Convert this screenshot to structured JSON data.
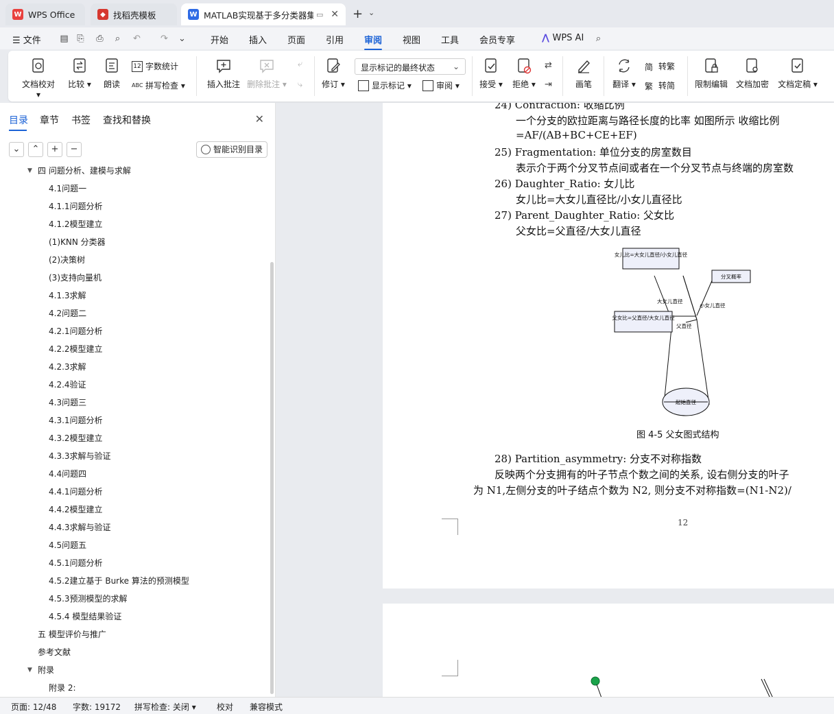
{
  "tabs": [
    {
      "label": "WPS Office",
      "icon": "wps-logo-icon"
    },
    {
      "label": "找稻壳模板",
      "icon": "docer-icon"
    },
    {
      "label": "MATLAB实现基于多分类器集",
      "icon": "word-doc-icon"
    }
  ],
  "menu": {
    "file": "文件",
    "items": [
      "开始",
      "插入",
      "页面",
      "引用",
      "审阅",
      "视图",
      "工具",
      "会员专享"
    ],
    "active": "审阅",
    "ai": "WPS AI"
  },
  "ribbon": {
    "doc_check": "文档校对",
    "compare": "比较",
    "read_aloud": "朗读",
    "word_count": "字数统计",
    "spell_check": "拼写检查",
    "insert_comment": "插入批注",
    "delete_comment": "删除批注",
    "revise": "修订",
    "markup_state": "显示标记的最终状态",
    "show_markup": "显示标记",
    "review": "审阅",
    "accept": "接受",
    "reject": "拒绝",
    "pen": "画笔",
    "translate": "翻译",
    "trad_simp": "转繁",
    "simp_trad": "转简",
    "restrict_edit": "限制编辑",
    "doc_encrypt": "文档加密",
    "doc_finalize": "文档定稿",
    "word_count_badge": "12",
    "abc_badge": "ABC"
  },
  "sidebar": {
    "tabs": [
      "目录",
      "章节",
      "书签",
      "查找和替换"
    ],
    "smart_button": "智能识别目录",
    "toc": [
      {
        "label": "四 问题分析、建模与求解",
        "level": 1,
        "arrow": true
      },
      {
        "label": "4.1问题一",
        "level": 2
      },
      {
        "label": "4.1.1问题分析",
        "level": 2
      },
      {
        "label": "4.1.2模型建立",
        "level": 2
      },
      {
        "label": "(1)KNN 分类器",
        "level": 2
      },
      {
        "label": "(2)决策树",
        "level": 2
      },
      {
        "label": "(3)支持向量机",
        "level": 2
      },
      {
        "label": "4.1.3求解",
        "level": 2
      },
      {
        "label": "4.2问题二",
        "level": 2
      },
      {
        "label": "4.2.1问题分析",
        "level": 2
      },
      {
        "label": "4.2.2模型建立",
        "level": 2
      },
      {
        "label": "4.2.3求解",
        "level": 2
      },
      {
        "label": "4.2.4验证",
        "level": 2
      },
      {
        "label": "4.3问题三",
        "level": 2
      },
      {
        "label": "4.3.1问题分析",
        "level": 2
      },
      {
        "label": "4.3.2模型建立",
        "level": 2
      },
      {
        "label": "4.3.3求解与验证",
        "level": 2
      },
      {
        "label": "4.4问题四",
        "level": 2
      },
      {
        "label": "4.4.1问题分析",
        "level": 2
      },
      {
        "label": "4.4.2模型建立",
        "level": 2
      },
      {
        "label": "4.4.3求解与验证",
        "level": 2
      },
      {
        "label": "4.5问题五",
        "level": 2
      },
      {
        "label": "4.5.1问题分析",
        "level": 2
      },
      {
        "label": "4.5.2建立基于 Burke 算法的预测模型",
        "level": 2
      },
      {
        "label": "4.5.3预测模型的求解",
        "level": 2
      },
      {
        "label": "4.5.4 模型结果验证",
        "level": 2
      },
      {
        "label": "五 模型评价与推广",
        "level": 1
      },
      {
        "label": "参考文献",
        "level": 1
      },
      {
        "label": "附录",
        "level": 1,
        "arrow": true
      },
      {
        "label": "附录 2:",
        "level": 2
      }
    ]
  },
  "document": {
    "lines": [
      "24) Contraction: 收缩比例",
      "一个分支的欧拉距离与路径长度的比率 如图所示 收缩比例",
      "=AF/(AB+BC+CE+EF)",
      "25) Fragmentation: 单位分支的房室数目",
      "表示介于两个分叉节点间或者在一个分叉节点与终端的房室数",
      "26) Daughter_Ratio: 女儿比",
      "女儿比=大女儿直径比/小女儿直径比",
      "27) Parent_Daughter_Ratio: 父女比",
      "父女比=父直径/大女儿直径"
    ],
    "figure": {
      "box_daughter_ratio": "女儿比=大女儿直径/小女儿直径",
      "box_branch_ratio": "分叉概率",
      "box_parent_ratio": "父女比=父直径/大女儿直径",
      "label_big_daughter": "大女儿直径",
      "label_small_daughter": "小女儿直径",
      "label_parent": "父直径",
      "label_start": "起始直径",
      "caption": "图 4-5 父女图式结构"
    },
    "after_lines": [
      "28) Partition_asymmetry: 分支不对称指数",
      "反映两个分支拥有的叶子节点个数之间的关系, 设右侧分支的叶子",
      "为 N1,左侧分支的叶子结点个数为 N2, 则分支不对称指数=(N1-N2)/"
    ],
    "page_number": "12"
  },
  "status": {
    "page": "页面: 12/48",
    "words": "字数: 19172",
    "spell": "拼写检查: 关闭",
    "proof": "校对",
    "compat": "兼容模式"
  },
  "colors": {
    "accent": "#1b62d6",
    "wps_red": "#e8413e",
    "docer_red": "#d6382f",
    "word_blue": "#2f6be5"
  }
}
